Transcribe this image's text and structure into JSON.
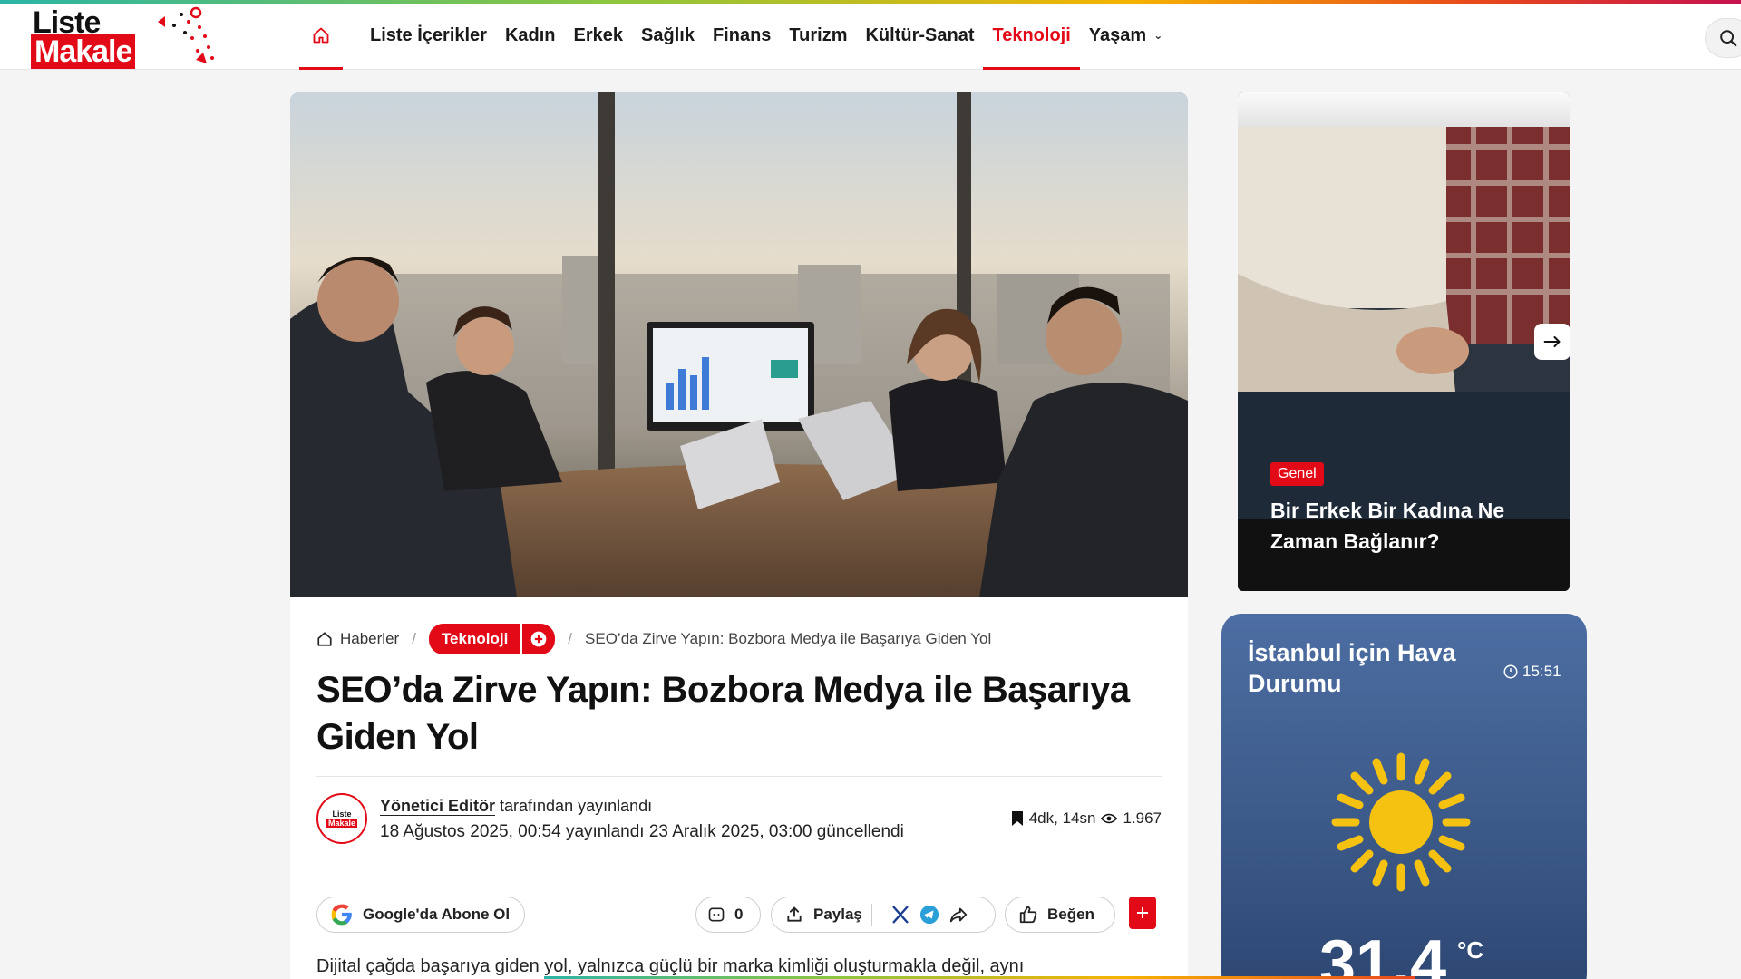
{
  "logo": {
    "line1": "Liste",
    "line2": "Makale"
  },
  "nav": {
    "items": [
      "Liste İçerikler",
      "Kadın",
      "Erkek",
      "Sağlık",
      "Finans",
      "Turizm",
      "Kültür-Sanat",
      "Teknoloji",
      "Yaşam"
    ],
    "active": "Teknoloji"
  },
  "breadcrumb": {
    "home": "Haberler",
    "category": "Teknoloji",
    "current": "SEO’da Zirve Yapın: Bozbora Medya ile Başarıya Giden Yol"
  },
  "article": {
    "title": "SEO’da Zirve Yapın: Bozbora Medya ile Başarıya Giden Yol",
    "author_name": "Yönetici Editör",
    "author_suffix": " tarafından yayınlandı",
    "dates": "18 Ağustos 2025, 00:54 yayınlandı 23 Aralık 2025, 03:00 güncellendi",
    "read_time": "4dk, 14sn",
    "views": "1.967",
    "avatar_line1": "Liste",
    "avatar_line2": "Makale",
    "intro": "Dijital çağda başarıya giden yol, yalnızca güçlü bir marka kimliği oluşturmakla değil, aynı"
  },
  "actions": {
    "google": "Google'da Abone Ol",
    "comments": "0",
    "share": "Paylaş",
    "like": "Beğen"
  },
  "side_card": {
    "badge": "Genel",
    "caption": "Bir Erkek Bir Kadına Ne Zaman Bağlanır?"
  },
  "weather": {
    "title": "İstanbul için Hava Durumu",
    "time": "15:51",
    "temp": "31,4",
    "unit": "°C"
  },
  "colors": {
    "accent": "#e30a17",
    "weather_bg": "#3c5a89",
    "sun": "#f5c211"
  },
  "icons": [
    "home-icon",
    "search-icon",
    "chevron-down-icon",
    "plus-icon",
    "bookmark-icon",
    "eye-icon",
    "google-icon",
    "comment-icon",
    "share-icon",
    "x-icon",
    "telegram-icon",
    "forward-icon",
    "thumbs-up-icon",
    "arrow-right-icon",
    "clock-icon",
    "sun-icon"
  ]
}
